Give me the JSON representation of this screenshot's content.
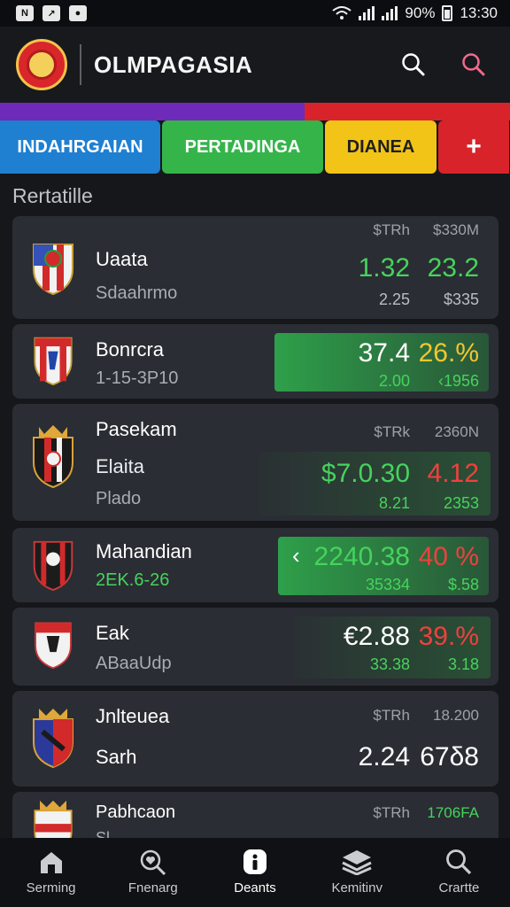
{
  "status_bar": {
    "battery": "90%",
    "time": "13:30"
  },
  "header": {
    "title": "OLMPAGASIA"
  },
  "tabs": [
    {
      "label": "INDAHRGAIAN"
    },
    {
      "label": "PERTADINGA"
    },
    {
      "label": "DIANEA"
    },
    {
      "label": "+"
    }
  ],
  "section_title": "Rertatille",
  "cards": [
    {
      "name": "Uaata",
      "sub": "Sdaahrmo",
      "col1_header": "$TRh",
      "col2_header": "$330M",
      "col1_main": "1.32",
      "col2_main": "23.2",
      "col1_sub": "2.25",
      "col2_sub": "$335"
    },
    {
      "name": "Bonrcra",
      "sub": "1-15-3P10",
      "col1_main": "37.4",
      "col2_main": "26.%",
      "col1_sub": "2.00",
      "col2_sub": "‹1956"
    },
    {
      "name": "Pasekam",
      "sub": "Elaita",
      "sub2": "Plado",
      "col1_header": "$TRk",
      "col2_header": "2360N",
      "col1_main": "$7.0.30",
      "col2_main": "4.12",
      "col1_sub": "8.21",
      "col2_sub": "2353"
    },
    {
      "name": "Mahandian",
      "sub": "2EK.6-26",
      "arrow": "‹",
      "col1_main": "2240.38",
      "col2_main": "40 %",
      "col1_sub": "35334",
      "col2_sub": "$.58"
    },
    {
      "name": "Eak",
      "sub": "ABaaUdp",
      "col1_main": "€2.88",
      "col2_main": "39.%",
      "col1_sub": "33.38",
      "col2_sub": "3.18"
    },
    {
      "name": "Jnlteuea",
      "sub": "Sarh",
      "col1_header": "$TRh",
      "col2_header": "18.200",
      "col1_main": "2.24",
      "col2_main": "67δ8"
    },
    {
      "name": "Pabhcaon",
      "sub": "Sl...",
      "col1_header": "$TRh",
      "col2_header": "1706FA"
    }
  ],
  "nav": [
    {
      "label": "Serming",
      "icon": "home-icon"
    },
    {
      "label": "Fnenarg",
      "icon": "search-heart-icon"
    },
    {
      "label": "Deants",
      "icon": "info-icon"
    },
    {
      "label": "Kemitinv",
      "icon": "stack-icon"
    },
    {
      "label": "Crartte",
      "icon": "search-icon"
    }
  ]
}
